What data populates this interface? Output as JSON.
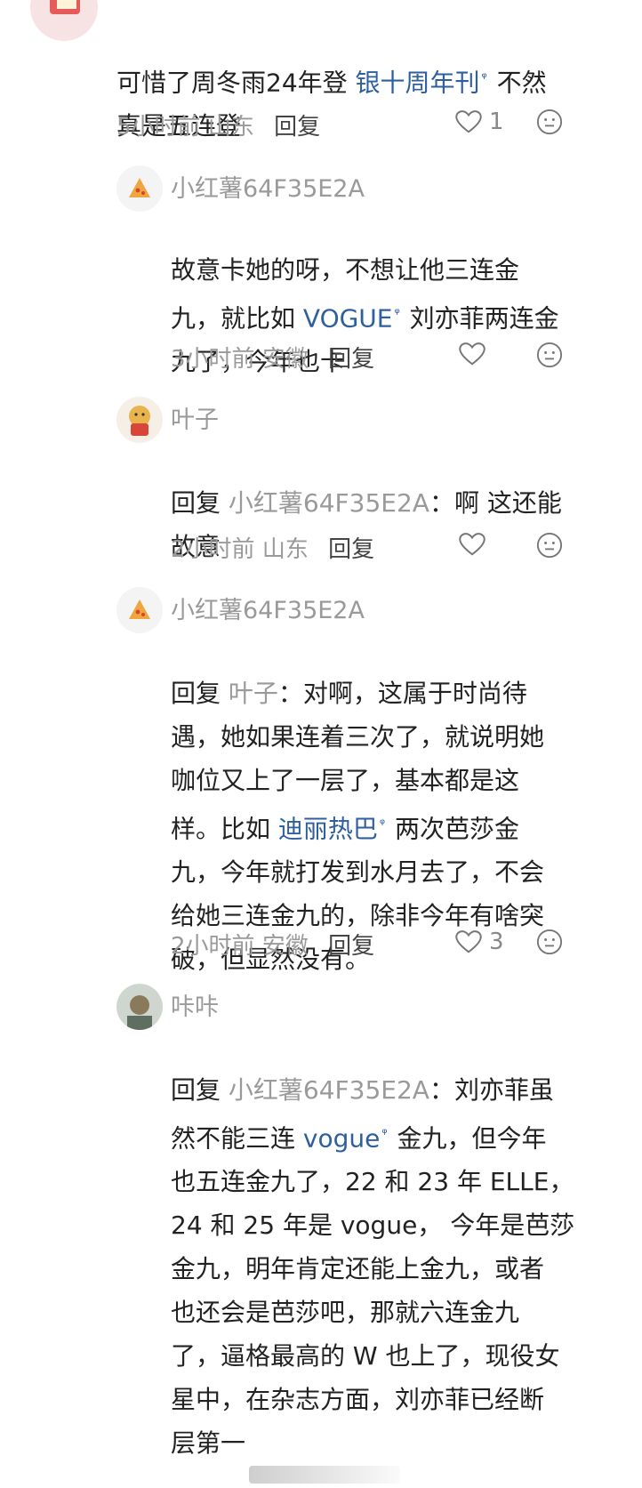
{
  "comments": [
    {
      "user": "",
      "body_parts": [
        {
          "text": "可惜了周冬雨24年登 ",
          "type": "text"
        },
        {
          "text": "银十周年刊",
          "type": "link"
        },
        {
          "text": "  不然\n真是五连登",
          "type": "text"
        }
      ],
      "time": "5小时前",
      "location": "山东",
      "reply": "回复",
      "likes": "1"
    },
    {
      "user": "小红薯64F35E2A",
      "body_parts": [
        {
          "text": "故意卡她的呀，不想让他三连金\n九，就比如 ",
          "type": "text"
        },
        {
          "text": "VOGUE",
          "type": "link"
        },
        {
          "text": " 刘亦菲两连金\n九了，今年也卡",
          "type": "text"
        }
      ],
      "time": "3小时前",
      "location": "安徽",
      "reply": "回复",
      "likes": ""
    },
    {
      "user": "叶子",
      "body_parts": [
        {
          "text": "回复 ",
          "type": "text"
        },
        {
          "text": "小红薯64F35E2A",
          "type": "mention"
        },
        {
          "text": "：啊 这还能\n故意",
          "type": "text"
        }
      ],
      "time": "2小时前",
      "location": "山东",
      "reply": "回复",
      "likes": ""
    },
    {
      "user": "小红薯64F35E2A",
      "body_parts": [
        {
          "text": "回复 ",
          "type": "text"
        },
        {
          "text": "叶子",
          "type": "mention"
        },
        {
          "text": "：对啊，这属于时尚待\n遇，她如果连着三次了，就说明她\n咖位又上了一层了，基本都是这\n样。比如 ",
          "type": "text"
        },
        {
          "text": "迪丽热巴",
          "type": "link"
        },
        {
          "text": " 两次芭莎金\n九，今年就打发到水月去了，不会\n给她三连金九的，除非今年有啥突\n破，但显然没有。",
          "type": "text"
        }
      ],
      "time": "2小时前",
      "location": "安徽",
      "reply": "回复",
      "likes": "3"
    },
    {
      "user": "咔咔",
      "body_parts": [
        {
          "text": "回复 ",
          "type": "text"
        },
        {
          "text": "小红薯64F35E2A",
          "type": "mention"
        },
        {
          "text": "：刘亦菲虽\n然不能三连 ",
          "type": "text"
        },
        {
          "text": "vogue",
          "type": "link"
        },
        {
          "text": " 金九，但今年\n也五连金九了，22 和 23 年 ELLE，\n24 和 25 年是 vogue， 今年是芭莎\n金九，明年肯定还能上金九，或者\n也还会是芭莎吧，那就六连金九\n了，逼格最高的 W 也上了，现役女\n星中，在杂志方面，刘亦菲已经断\n层第一",
          "type": "text"
        }
      ],
      "time": "",
      "location": "",
      "reply": "",
      "likes": ""
    }
  ],
  "icons": {
    "like": "heart-outline-icon",
    "emoji": "neutral-face-icon",
    "search_mark": "search-icon"
  },
  "colors": {
    "link": "#2e5f9e",
    "muted": "#9a9a9a",
    "text": "#222222"
  }
}
